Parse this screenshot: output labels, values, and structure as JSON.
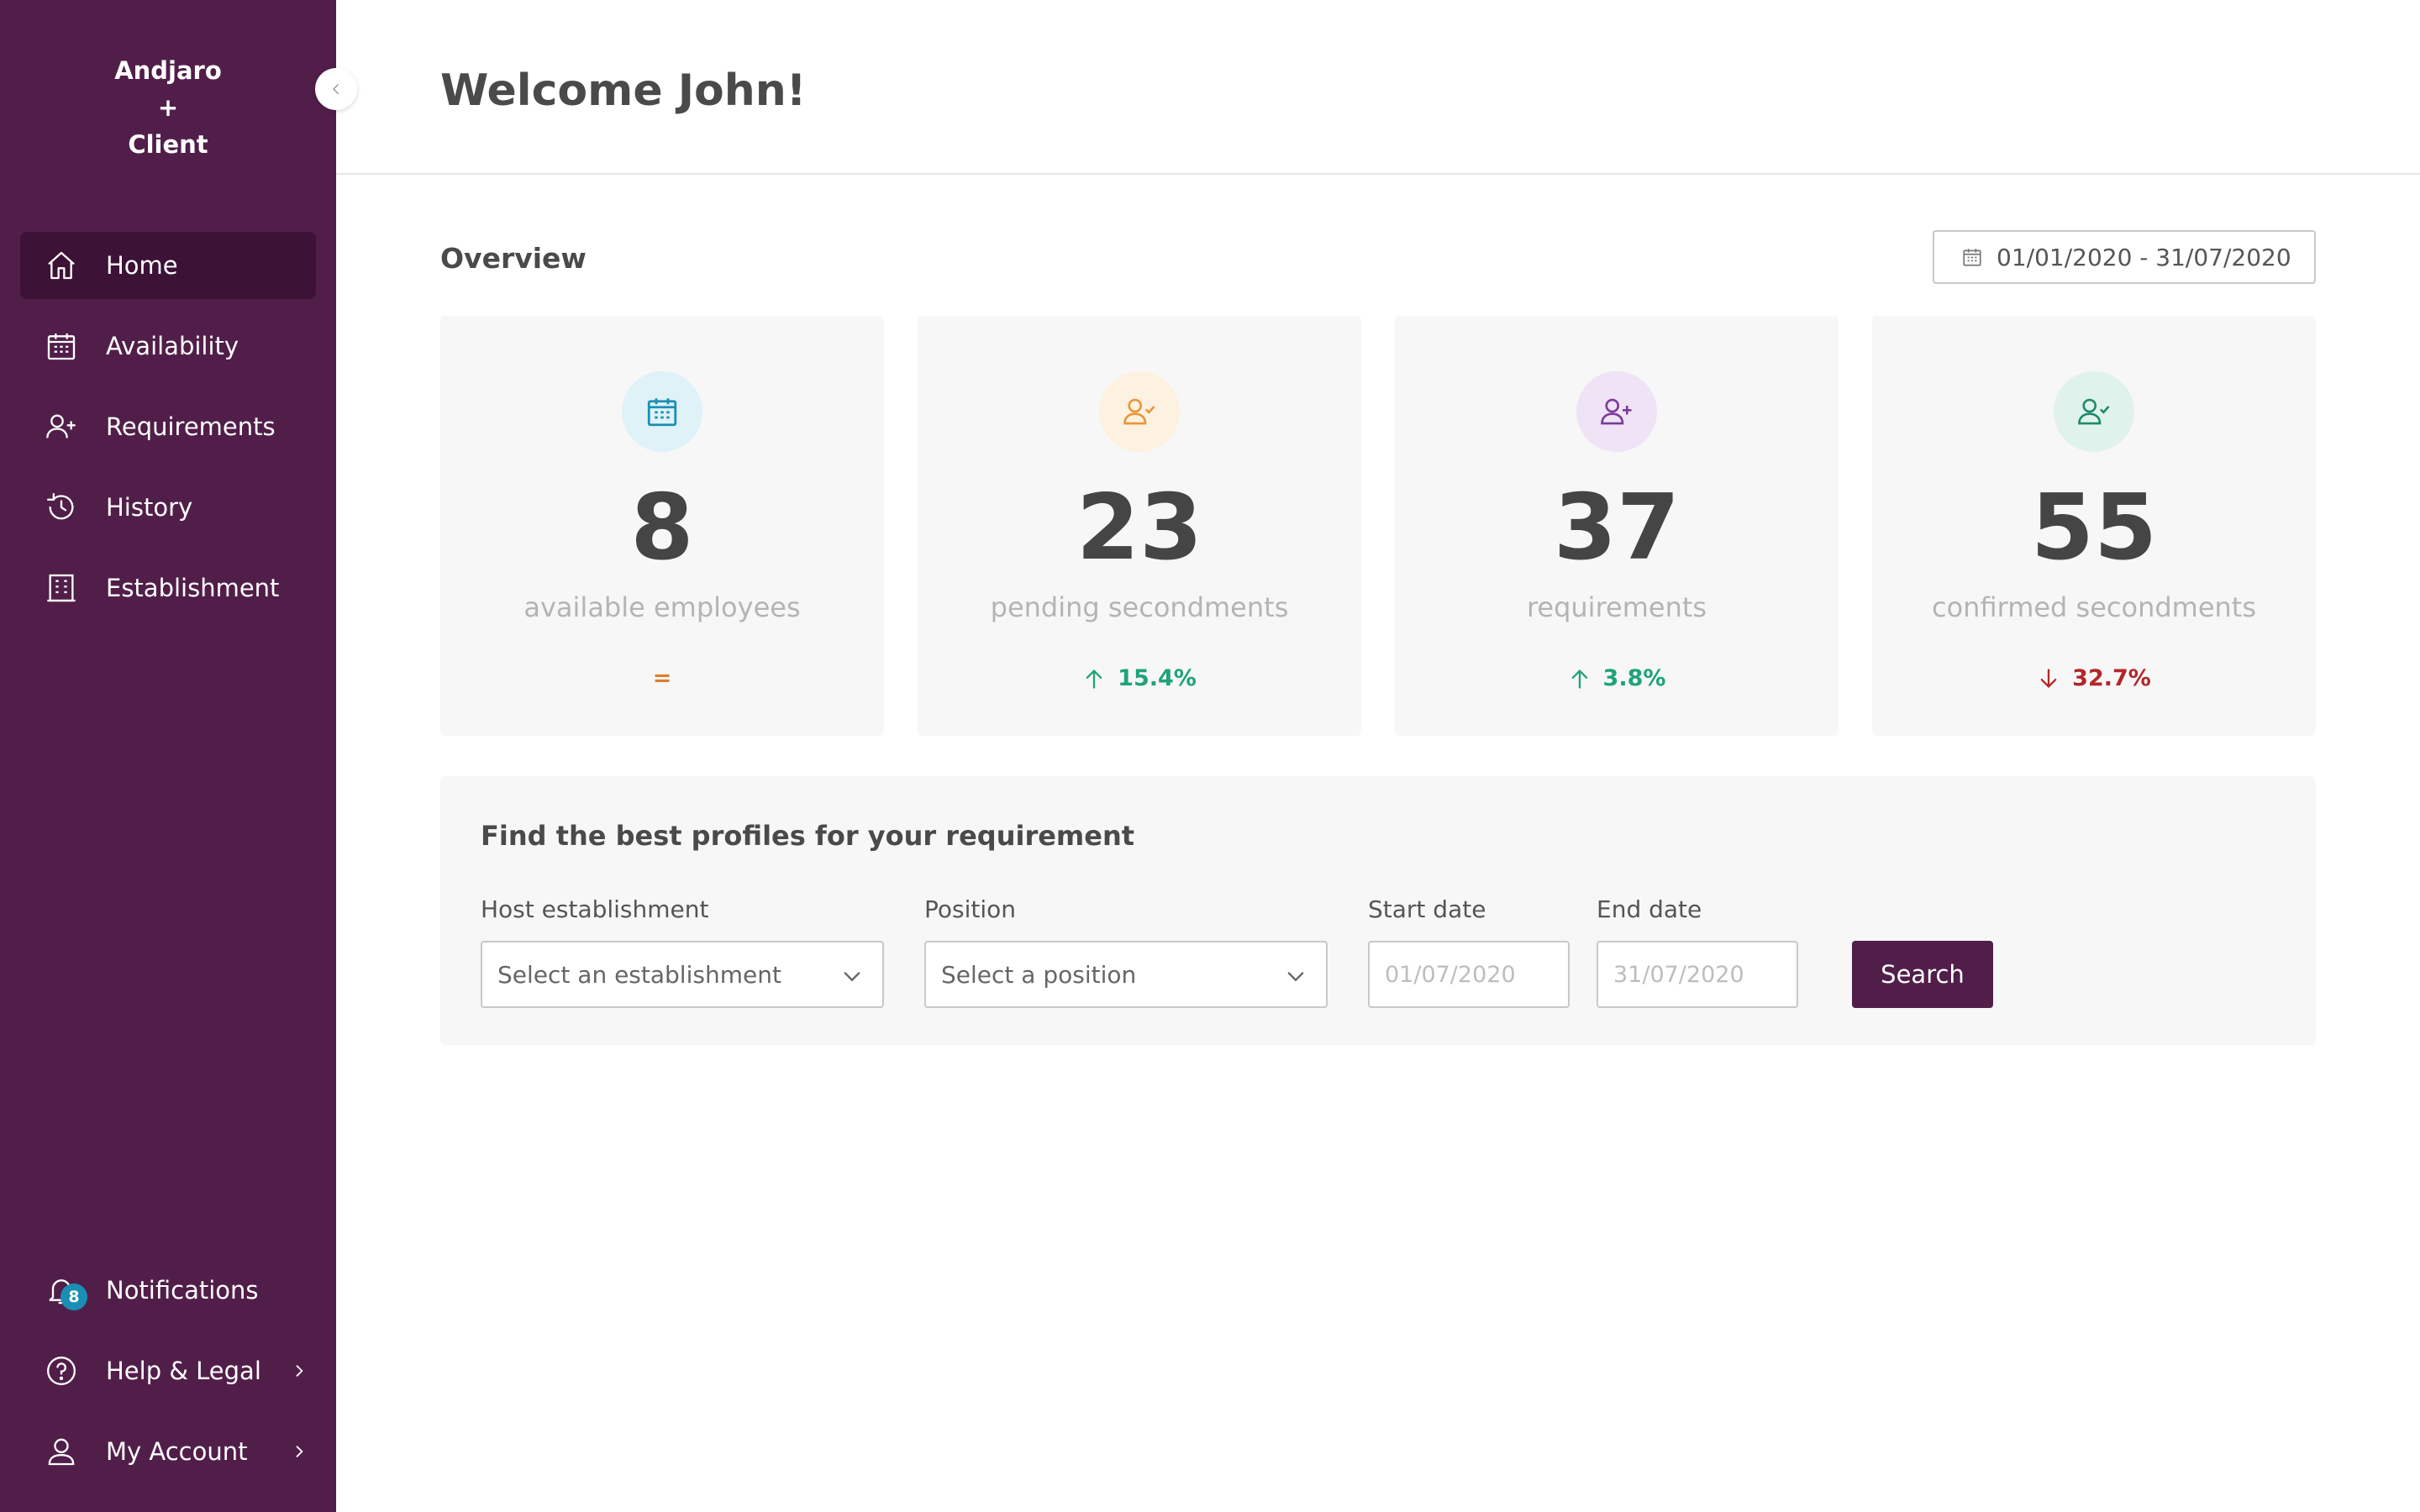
{
  "brand": {
    "line1": "Andjaro",
    "line2": "+",
    "line3": "Client"
  },
  "sidebar": {
    "items": [
      {
        "label": "Home",
        "icon": "home-icon",
        "active": true
      },
      {
        "label": "Availability",
        "icon": "calendar-icon"
      },
      {
        "label": "Requirements",
        "icon": "user-plus-icon"
      },
      {
        "label": "History",
        "icon": "history-icon"
      },
      {
        "label": "Establishment",
        "icon": "building-icon"
      }
    ],
    "bottom": [
      {
        "label": "Notifications",
        "icon": "bell-icon",
        "badge": "8"
      },
      {
        "label": "Help & Legal",
        "icon": "help-icon"
      },
      {
        "label": "My Account",
        "icon": "user-icon"
      }
    ]
  },
  "header": {
    "title": "Welcome John!"
  },
  "overview": {
    "title": "Overview",
    "date_range": "01/01/2020 - 31/07/2020",
    "cards": [
      {
        "value": "8",
        "caption": "available employees",
        "trend": "=",
        "trend_dir": "flat",
        "color": "#e07b2c",
        "icon_bg": "#def2f7"
      },
      {
        "value": "23",
        "caption": "pending secondments",
        "trend": "15.4%",
        "trend_dir": "up",
        "color": "#1fa37a",
        "icon_bg": "#fdf1df"
      },
      {
        "value": "37",
        "caption": "requirements",
        "trend": "3.8%",
        "trend_dir": "up",
        "color": "#1fa37a",
        "icon_bg": "#efe3f5"
      },
      {
        "value": "55",
        "caption": "confirmed secondments",
        "trend": "32.7%",
        "trend_dir": "down",
        "color": "#b3262a",
        "icon_bg": "#dff3ec"
      }
    ]
  },
  "search": {
    "title": "Find the best profiles for your requirement",
    "host_label": "Host establishment",
    "host_placeholder": "Select an establishment",
    "position_label": "Position",
    "position_placeholder": "Select a position",
    "start_label": "Start date",
    "start_value": "01/07/2020",
    "end_label": "End date",
    "end_value": "31/07/2020",
    "button": "Search"
  },
  "colors": {
    "sidebar": "#511e4a",
    "sidebar_active": "#3c1236",
    "badge": "#1a8fb3"
  }
}
